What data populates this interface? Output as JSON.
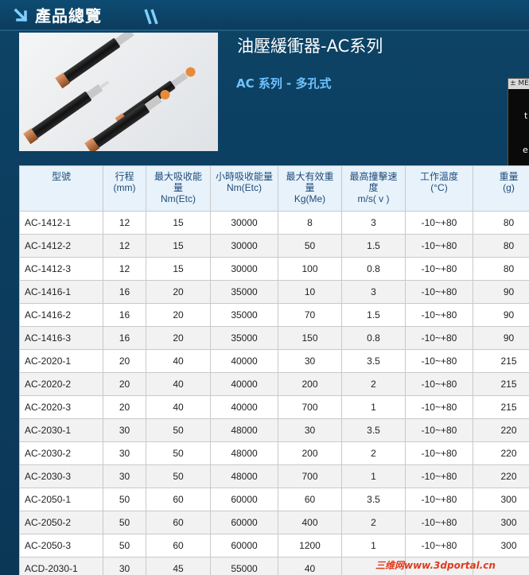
{
  "header": {
    "title": "產品總覽"
  },
  "product": {
    "title": "油壓緩衝器-AC系列",
    "subtitle": "AC 系列 - 多孔式"
  },
  "side_widget": {
    "top_label": "± ME",
    "text1": "t",
    "text2": "e"
  },
  "table": {
    "headers": [
      [
        "型號"
      ],
      [
        "行程",
        "(mm)"
      ],
      [
        "最大吸收能",
        "量",
        "Nm(Etc)"
      ],
      [
        "小時吸收能量",
        "Nm(Etc)"
      ],
      [
        "最大有效重",
        "量",
        "Kg(Me)"
      ],
      [
        "最高撞擊速",
        "度",
        "m/s( v )"
      ],
      [
        "工作溫度",
        "(°C)"
      ],
      [
        "重量",
        "(g)"
      ]
    ],
    "rows": [
      [
        "AC-1412-1",
        "12",
        "15",
        "30000",
        "8",
        "3",
        "-10~+80",
        "80"
      ],
      [
        "AC-1412-2",
        "12",
        "15",
        "30000",
        "50",
        "1.5",
        "-10~+80",
        "80"
      ],
      [
        "AC-1412-3",
        "12",
        "15",
        "30000",
        "100",
        "0.8",
        "-10~+80",
        "80"
      ],
      [
        "AC-1416-1",
        "16",
        "20",
        "35000",
        "10",
        "3",
        "-10~+80",
        "90"
      ],
      [
        "AC-1416-2",
        "16",
        "20",
        "35000",
        "70",
        "1.5",
        "-10~+80",
        "90"
      ],
      [
        "AC-1416-3",
        "16",
        "20",
        "35000",
        "150",
        "0.8",
        "-10~+80",
        "90"
      ],
      [
        "AC-2020-1",
        "20",
        "40",
        "40000",
        "30",
        "3.5",
        "-10~+80",
        "215"
      ],
      [
        "AC-2020-2",
        "20",
        "40",
        "40000",
        "200",
        "2",
        "-10~+80",
        "215"
      ],
      [
        "AC-2020-3",
        "20",
        "40",
        "40000",
        "700",
        "1",
        "-10~+80",
        "215"
      ],
      [
        "AC-2030-1",
        "30",
        "50",
        "48000",
        "30",
        "3.5",
        "-10~+80",
        "220"
      ],
      [
        "AC-2030-2",
        "30",
        "50",
        "48000",
        "200",
        "2",
        "-10~+80",
        "220"
      ],
      [
        "AC-2030-3",
        "30",
        "50",
        "48000",
        "700",
        "1",
        "-10~+80",
        "220"
      ],
      [
        "AC-2050-1",
        "50",
        "60",
        "60000",
        "60",
        "3.5",
        "-10~+80",
        "300"
      ],
      [
        "AC-2050-2",
        "50",
        "60",
        "60000",
        "400",
        "2",
        "-10~+80",
        "300"
      ],
      [
        "AC-2050-3",
        "50",
        "60",
        "60000",
        "1200",
        "1",
        "-10~+80",
        "300"
      ],
      [
        "ACD-2030-1",
        "30",
        "45",
        "55000",
        "40",
        "",
        "",
        ""
      ]
    ]
  },
  "watermark": "三维网www.3dportal.cn"
}
